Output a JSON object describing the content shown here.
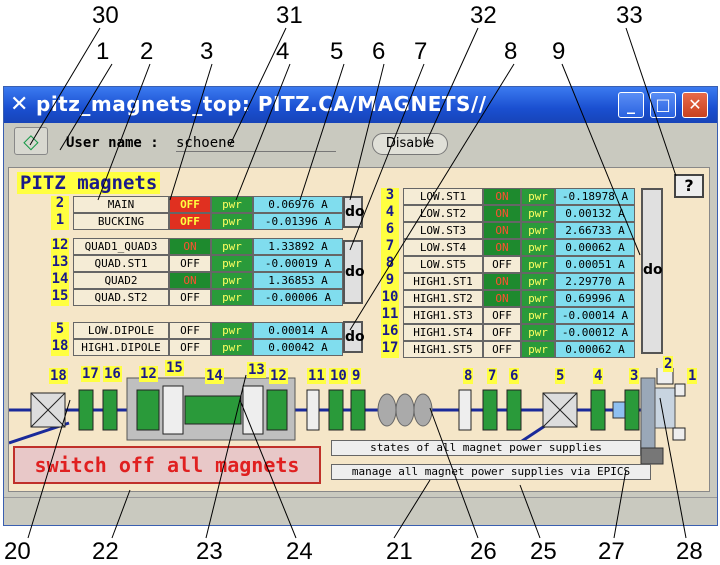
{
  "callouts_top": [
    "30",
    "31",
    "32",
    "33",
    "1",
    "2",
    "3",
    "4",
    "5",
    "6",
    "7",
    "8",
    "9"
  ],
  "callouts_bottom": [
    "20",
    "22",
    "23",
    "24",
    "21",
    "26",
    "25",
    "27",
    "28"
  ],
  "window": {
    "title": "pitz_magnets_top: PITZ.CA/MAGNETS//",
    "min_label": "_",
    "max_label": "□",
    "close_label": "✕"
  },
  "toolbar": {
    "home_icon": "◇",
    "user_label": "User name :",
    "user_value": "schoene",
    "disable_label": "Disable"
  },
  "panel": {
    "title": "PITZ magnets",
    "help_label": "?",
    "do_label": "do"
  },
  "left_groups": [
    {
      "rows": [
        {
          "idx": "2",
          "name": "MAIN",
          "state": "OFF",
          "pwr": "pwr",
          "cur": "0.06976 A",
          "style": "offred"
        },
        {
          "idx": "1",
          "name": "BUCKING",
          "state": "OFF",
          "pwr": "pwr",
          "cur": "-0.01396 A",
          "style": "offred"
        }
      ]
    },
    {
      "rows": [
        {
          "idx": "12",
          "name": "QUAD1_QUAD3",
          "state": "ON",
          "pwr": "pwr",
          "cur": "1.33892 A",
          "style": "on"
        },
        {
          "idx": "13",
          "name": "QUAD.ST1",
          "state": "OFF",
          "pwr": "pwr",
          "cur": "-0.00019 A",
          "style": "off"
        },
        {
          "idx": "14",
          "name": "QUAD2",
          "state": "ON",
          "pwr": "pwr",
          "cur": "1.36853 A",
          "style": "on"
        },
        {
          "idx": "15",
          "name": "QUAD.ST2",
          "state": "OFF",
          "pwr": "pwr",
          "cur": "-0.00006 A",
          "style": "off"
        }
      ]
    },
    {
      "rows": [
        {
          "idx": "5",
          "name": "LOW.DIPOLE",
          "state": "OFF",
          "pwr": "pwr",
          "cur": "0.00014 A",
          "style": "off"
        },
        {
          "idx": "18",
          "name": "HIGH1.DIPOLE",
          "state": "OFF",
          "pwr": "pwr",
          "cur": "0.00042 A",
          "style": "off"
        }
      ]
    }
  ],
  "right_rows": [
    {
      "idx": "3",
      "name": "LOW.ST1",
      "state": "ON",
      "pwr": "pwr",
      "cur": "-0.18978 A",
      "style": "on"
    },
    {
      "idx": "4",
      "name": "LOW.ST2",
      "state": "ON",
      "pwr": "pwr",
      "cur": "0.00132 A",
      "style": "on"
    },
    {
      "idx": "6",
      "name": "LOW.ST3",
      "state": "ON",
      "pwr": "pwr",
      "cur": "2.66733 A",
      "style": "on"
    },
    {
      "idx": "7",
      "name": "LOW.ST4",
      "state": "ON",
      "pwr": "pwr",
      "cur": "0.00062 A",
      "style": "on"
    },
    {
      "idx": "8",
      "name": "LOW.ST5",
      "state": "OFF",
      "pwr": "pwr",
      "cur": "0.00051 A",
      "style": "off"
    },
    {
      "idx": "9",
      "name": "HIGH1.ST1",
      "state": "ON",
      "pwr": "pwr",
      "cur": "2.29770 A",
      "style": "on"
    },
    {
      "idx": "10",
      "name": "HIGH1.ST2",
      "state": "ON",
      "pwr": "pwr",
      "cur": "0.69996 A",
      "style": "on"
    },
    {
      "idx": "11",
      "name": "HIGH1.ST3",
      "state": "OFF",
      "pwr": "pwr",
      "cur": "-0.00014 A",
      "style": "off"
    },
    {
      "idx": "16",
      "name": "HIGH1.ST4",
      "state": "OFF",
      "pwr": "pwr",
      "cur": "-0.00012 A",
      "style": "off"
    },
    {
      "idx": "17",
      "name": "HIGH1.ST5",
      "state": "OFF",
      "pwr": "pwr",
      "cur": "0.00062 A",
      "style": "off"
    }
  ],
  "beamline_labels": [
    "18",
    "17",
    "16",
    "12",
    "15",
    "14",
    "13",
    "12",
    "11",
    "10",
    "9",
    "8",
    "7",
    "6",
    "5",
    "4",
    "3",
    "2",
    "1"
  ],
  "buttons": {
    "switch_off": "switch off all magnets",
    "states": "states of all magnet power supplies",
    "manage": "manage all magnet power supplies via EPICS"
  },
  "colors": {
    "title_blue": "#1a4fd0",
    "panel_bg": "#f5e6c8",
    "label_yellow": "#ffff40",
    "on_green": "#1e8a2e",
    "off_red": "#e03020",
    "current_cyan": "#80ddee"
  }
}
